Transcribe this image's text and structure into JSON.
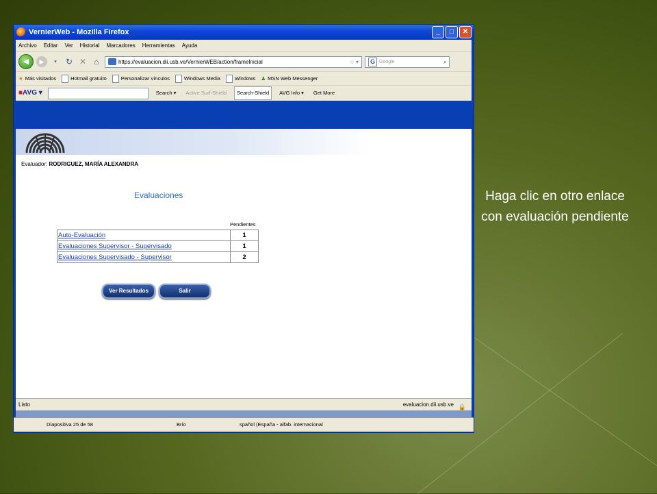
{
  "window": {
    "title": "VernierWeb - Mozilla Firefox"
  },
  "menu": [
    "Archivo",
    "Editar",
    "Ver",
    "Historial",
    "Marcadores",
    "Herramientas",
    "Ayuda"
  ],
  "address": {
    "url": "https://evaluacion.dii.usb.ve/VernierWEB/action/frameInicial",
    "search_placeholder": "Google"
  },
  "bookmarks": [
    "Más visitados",
    "Hotmail gratuito",
    "Personalizar vínculos",
    "Windows Media",
    "Windows",
    "MSN Web Messenger"
  ],
  "avg": {
    "logo": "AVG",
    "search": "Search",
    "surf": "Active Surf-Shield",
    "shield": "Search-Shield",
    "info": "AVG Info",
    "more": "Get More"
  },
  "page": {
    "evaluador_label": "Evaluador:",
    "evaluador_name": "RODRIGUEZ, MARÍA ALEXANDRA",
    "heading": "Evaluaciones",
    "pending_header": "Pendientes",
    "rows": [
      {
        "label": "Auto-Evaluación",
        "count": "1"
      },
      {
        "label": "Evaluaciones Supervisor - Supervisado",
        "count": "1"
      },
      {
        "label": "Evaluaciones Supervisado - Supervisor",
        "count": "2"
      }
    ],
    "results_button": "Ver Resultados",
    "exit_button": "Salir"
  },
  "status": {
    "left": "Listo",
    "right": "evaluacion.dii.usb.ve"
  },
  "ppt": {
    "slide": "Diapositiva 25 de 58",
    "theme": "Brío",
    "lang": "spañol (España - alfab. internacional"
  },
  "caption": "Haga clic en otro enlace con evaluación pendiente"
}
